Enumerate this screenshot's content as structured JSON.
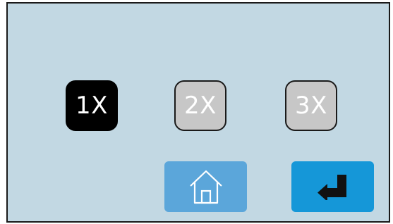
{
  "multipliers": {
    "options": [
      {
        "label": "1X",
        "selected": true
      },
      {
        "label": "2X",
        "selected": false
      },
      {
        "label": "3X",
        "selected": false
      }
    ]
  },
  "actions": {
    "home_icon": "home-icon",
    "enter_icon": "enter-icon"
  },
  "colors": {
    "background": "#c2d8e3",
    "selected_button": "#000000",
    "unselected_button": "#c7c7c7",
    "home_button": "#5ba6da",
    "enter_button": "#1597d8"
  }
}
